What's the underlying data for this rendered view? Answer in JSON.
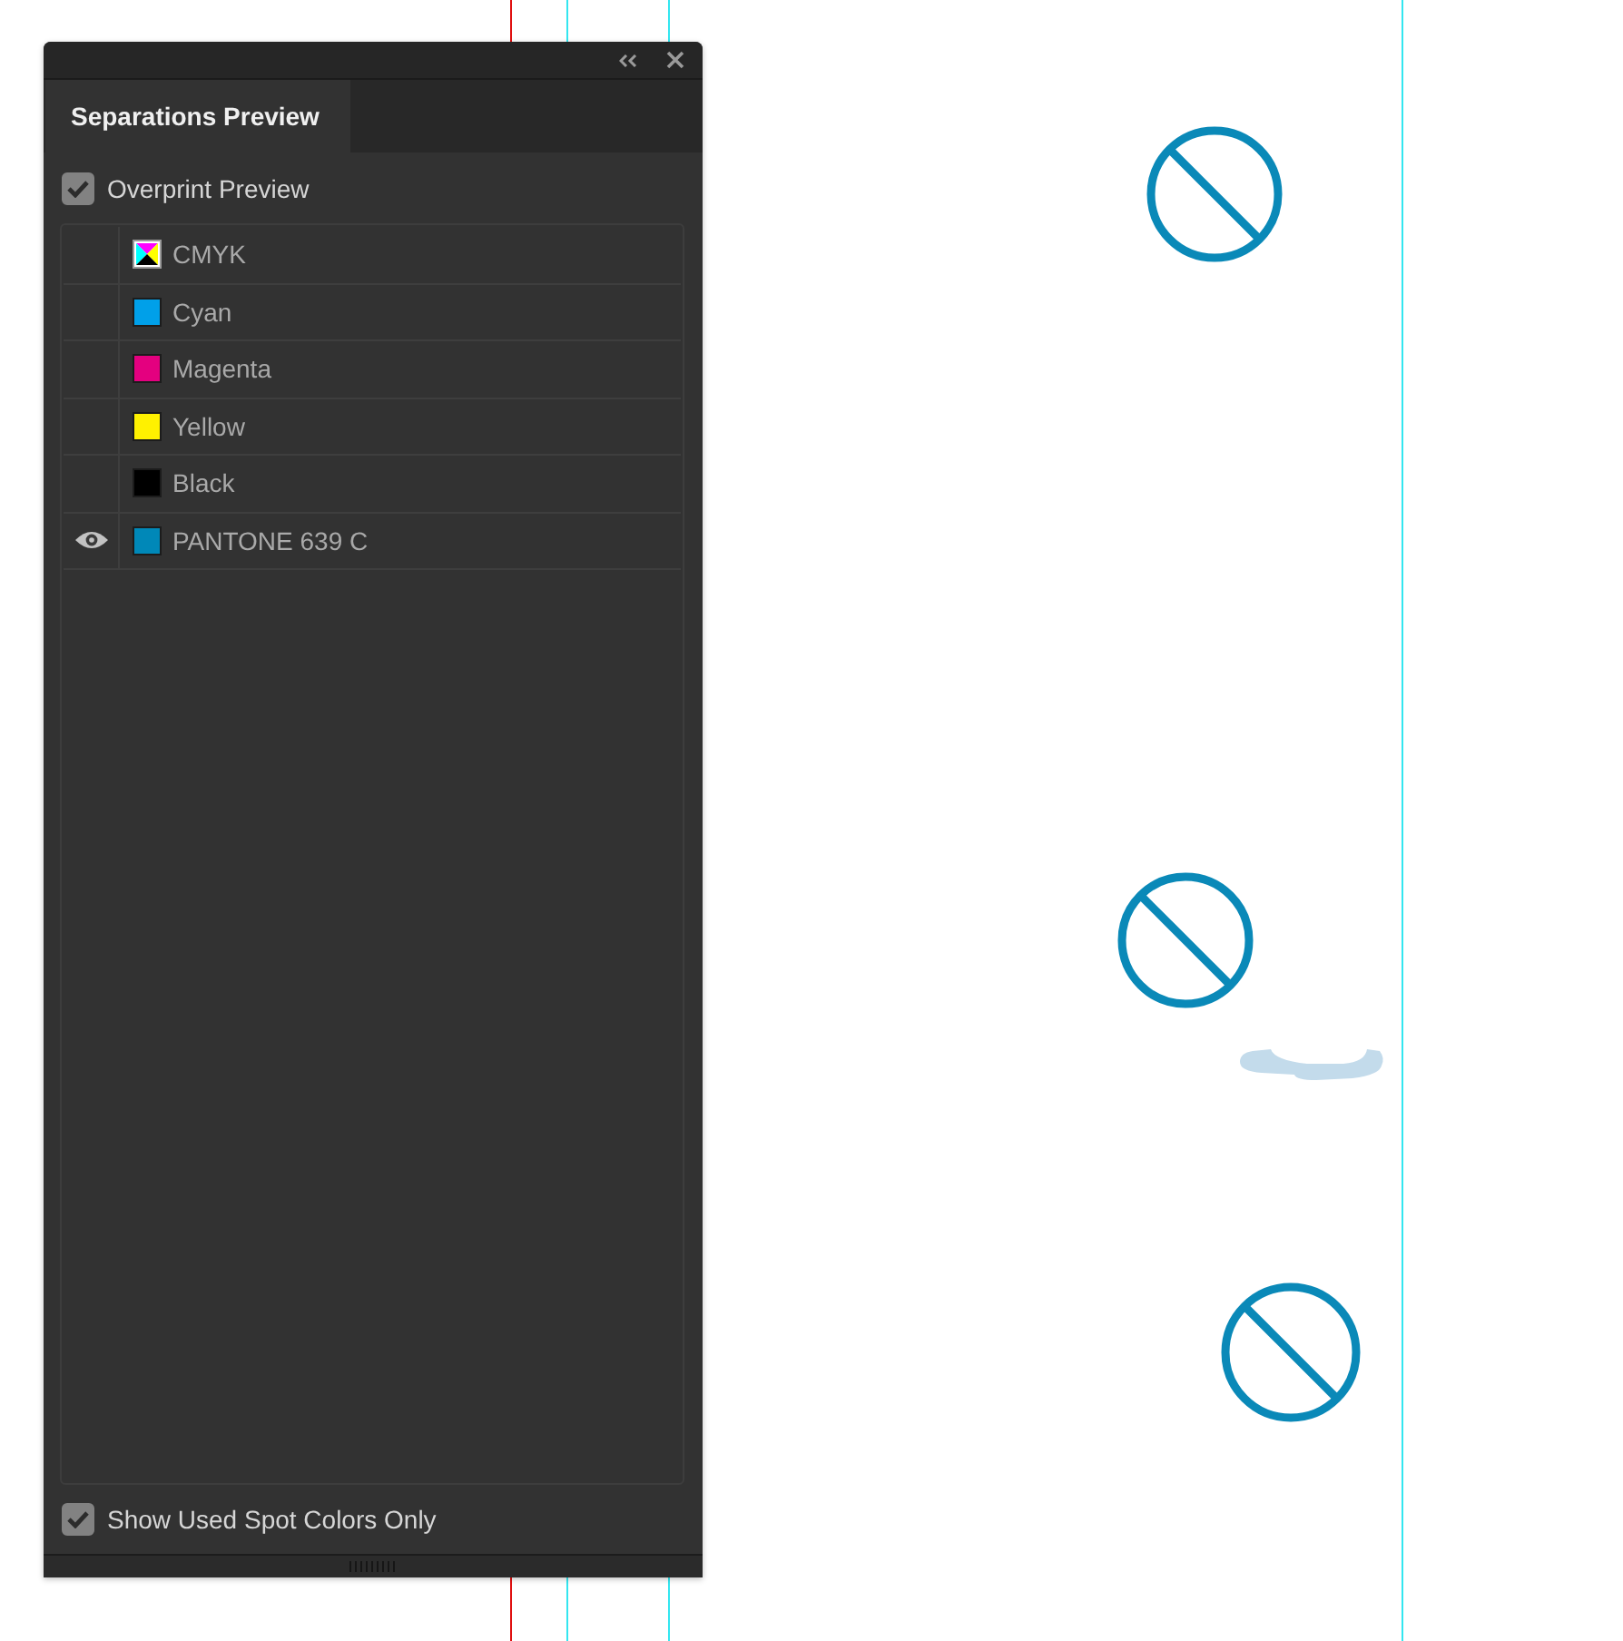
{
  "tabs": [
    {
      "label": "Separations Preview",
      "selected": true
    }
  ],
  "overprint_preview": {
    "label": "Overprint Preview",
    "checked": true
  },
  "separations": [
    {
      "name": "CMYK",
      "kind": "composite",
      "visible": false
    },
    {
      "name": "Cyan",
      "kind": "ink",
      "color": "#00a0e9",
      "visible": false
    },
    {
      "name": "Magenta",
      "kind": "ink",
      "color": "#e4007f",
      "visible": false
    },
    {
      "name": "Yellow",
      "kind": "ink",
      "color": "#fff100",
      "visible": false
    },
    {
      "name": "Black",
      "kind": "ink",
      "color": "#000000",
      "visible": false
    },
    {
      "name": "PANTONE 639 C",
      "kind": "ink",
      "color": "#0088b8",
      "visible": true
    }
  ],
  "show_used_spot_colors_only": {
    "label": "Show Used Spot Colors Only",
    "checked": true
  }
}
